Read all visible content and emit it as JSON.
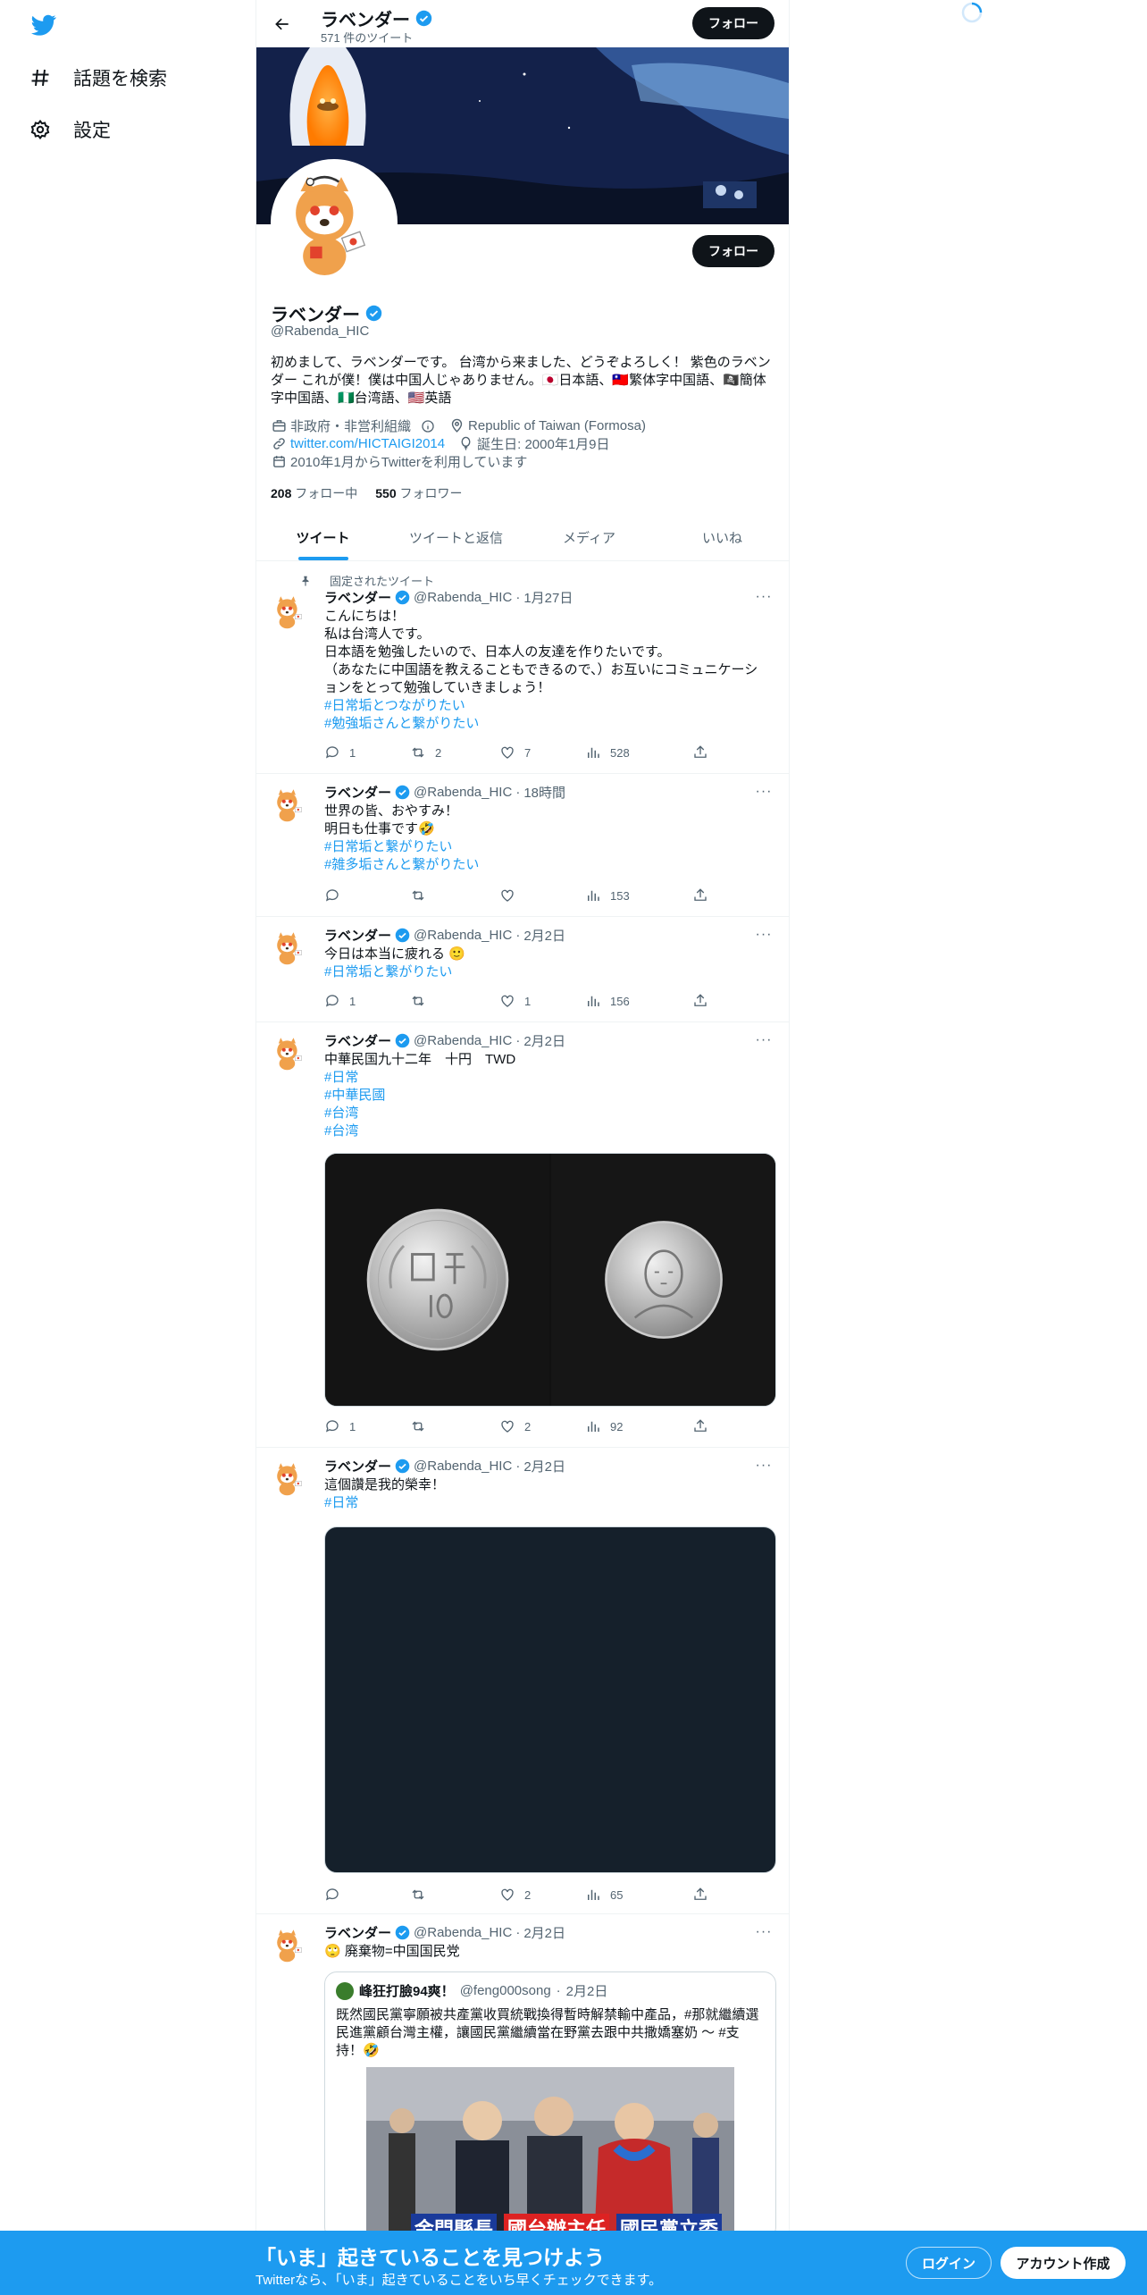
{
  "sidebar": {
    "logo_icon": "twitter-bird-icon",
    "items": [
      {
        "label": "話題を検索",
        "icon": "hashtag-icon"
      },
      {
        "label": "設定",
        "icon": "gear-icon"
      }
    ]
  },
  "header": {
    "name": "ラベンダー",
    "tweet_count": "571 件のツイート",
    "follow_label": "フォロー"
  },
  "profile": {
    "name": "ラベンダー",
    "handle": "@Rabenda_HIC",
    "follow_label": "フォロー",
    "bio_lines": [
      "初めまして、ラベンダーです。 台湾から来ました、どうぞよろしく！ 紫色のラベン",
      "ダー これが僕！僕は中国人じゃありません。🇯🇵日本語、🇹🇼繁体字中国語、🏴‍☠️簡体",
      "字中国語、🇳🇬台湾語、🇺🇸英語"
    ],
    "category": "非政府・非営利組織",
    "location": "Republic of Taiwan (Formosa)",
    "website": "twitter.com/HICTAIGI2014",
    "birthday": "誕生日: 2000年1月9日",
    "joined": "2010年1月からTwitterを利用しています",
    "following_count": "208",
    "following_label": "フォロー中",
    "followers_count": "550",
    "followers_label": "フォロワー"
  },
  "tabs": [
    "ツイート",
    "ツイートと返信",
    "メディア",
    "いいね"
  ],
  "pinned_label": "固定されたツイート",
  "tweets": [
    {
      "name": "ラベンダー",
      "handle": "@Rabenda_HIC",
      "time": "1月27日",
      "lines": [
        "こんにちは！",
        "私は台湾人です。",
        "日本語を勉強したいので、日本人の友達を作りたいです。",
        "（あなたに中国語を教えることもできるので、）お互いにコミュニケーシ",
        "ョンをとって勉強していきましょう！"
      ],
      "tags": [
        "#日常垢とつながりたい",
        "#勉強垢さんと繋がりたい"
      ],
      "reply": "1",
      "retweet": "2",
      "like": "7",
      "views": "528"
    },
    {
      "name": "ラベンダー",
      "handle": "@Rabenda_HIC",
      "time": "18時間",
      "lines": [
        "世界の皆、おやすみ！",
        "明日も仕事です🤣"
      ],
      "tags": [
        "#日常垢と繋がりたい",
        "#雑多垢さんと繋がりたい"
      ],
      "reply": "",
      "retweet": "",
      "like": "",
      "views": "153"
    },
    {
      "name": "ラベンダー",
      "handle": "@Rabenda_HIC",
      "time": "2月2日",
      "lines": [
        "今日は本当に疲れる 🙂"
      ],
      "tags": [
        "#日常垢と繋がりたい"
      ],
      "reply": "1",
      "retweet": "",
      "like": "1",
      "views": "156"
    },
    {
      "name": "ラベンダー",
      "handle": "@Rabenda_HIC",
      "time": "2月2日",
      "lines": [
        "中華民国九十二年　十円　TWD"
      ],
      "tags": [
        "#日常",
        "#中華民國",
        "#台湾",
        "#台湾"
      ],
      "reply": "1",
      "retweet": "",
      "like": "2",
      "views": "92"
    },
    {
      "name": "ラベンダー",
      "handle": "@Rabenda_HIC",
      "time": "2月2日",
      "lines": [
        "這個讚是我的榮幸！"
      ],
      "tags": [
        "#日常"
      ],
      "reply": "",
      "retweet": "",
      "like": "2",
      "views": "65"
    },
    {
      "name": "ラベンダー",
      "handle": "@Rabenda_HIC",
      "time": "2月2日",
      "lines": [
        "🙄 廃棄物=中国国民党"
      ],
      "tags": [],
      "quote": {
        "name": "峰狂打臉94爽！",
        "handle": "@feng000song",
        "time": "2月2日",
        "lines": [
          "既然國民黨寧願被共產黨收買統戰換得暫時解禁輸中產品，#那就繼續選",
          "民進黨顧台灣主權，讓國民黨繼續當在野黨去跟中共撒嬌塞奶 ～ #支",
          "持！🤣"
        ],
        "caption_left": "金門縣長",
        "caption_mid": "國台辦主任",
        "caption_right": "國民黨立委"
      }
    }
  ],
  "bottom_bar": {
    "title": "「いま」起きていることを見つけよう",
    "subtitle": "Twitterなら、「いま」起きていることをいち早くチェックできます。",
    "login": "ログイン",
    "signup": "アカウント作成"
  }
}
